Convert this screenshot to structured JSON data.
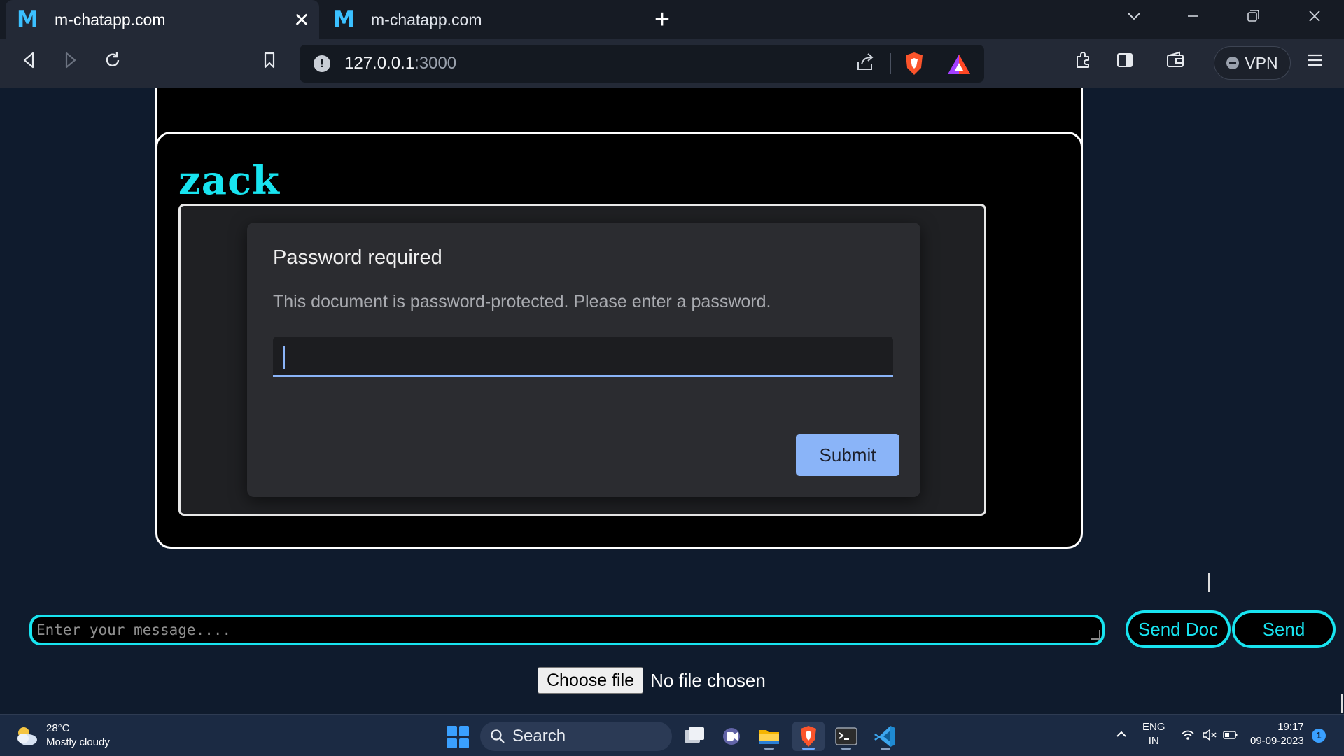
{
  "browser": {
    "tabs": [
      {
        "favicon": "M",
        "title": "m-chatapp.com",
        "close": "✕",
        "active": true
      },
      {
        "favicon": "M",
        "title": "m-chatapp.com",
        "active": false
      }
    ],
    "new_tab": "+",
    "address": {
      "host": "127.0.0.1",
      "port": ":3000"
    },
    "vpn_label": "VPN",
    "icons": [
      "back-icon",
      "forward-icon",
      "reload-icon",
      "bookmark-icon",
      "site-info-icon",
      "share-icon",
      "brave-shield-icon",
      "brave-rewards-icon",
      "extensions-icon",
      "sidebar-icon",
      "wallet-icon",
      "menu-icon",
      "tab-search-icon",
      "minimize-icon",
      "restore-icon",
      "close-window-icon"
    ]
  },
  "chat": {
    "message": {
      "sender": "zack",
      "pdf_dialog": {
        "title": "Password required",
        "description": "This document is password-protected. Please enter a password.",
        "password_value": "",
        "submit_label": "Submit"
      }
    },
    "composer": {
      "placeholder": "Enter your message....",
      "send_doc_label": "Send Doc",
      "send_label": "Send",
      "choose_file_label": "Choose file",
      "file_status": "No file chosen"
    },
    "colors": {
      "accent": "#18e4f0",
      "card_bg": "#000000",
      "page_bg": "#0f1b2d",
      "dialog_button": "#8ab4f8"
    }
  },
  "taskbar": {
    "weather": {
      "temp": "28°C",
      "condition": "Mostly cloudy"
    },
    "search_label": "Search",
    "language": {
      "line1": "ENG",
      "line2": "IN"
    },
    "clock": {
      "time": "19:17",
      "date": "09-09-2023"
    },
    "notification_count": "1"
  }
}
